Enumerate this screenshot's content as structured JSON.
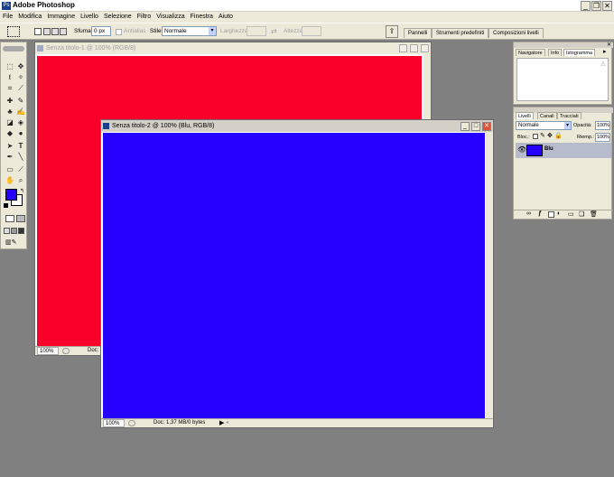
{
  "app": {
    "title": "Adobe Photoshop",
    "icon": "photoshop-icon"
  },
  "window_controls": [
    "_",
    "❐",
    "✕"
  ],
  "menu": [
    "File",
    "Modifica",
    "Immagine",
    "Livello",
    "Selezione",
    "Filtro",
    "Visualizza",
    "Finestra",
    "Aiuto"
  ],
  "options": {
    "sfuma_label": "Sfuma:",
    "sfuma_value": "0 px",
    "antialias_label": "Antialias",
    "stile_label": "Stile:",
    "stile_value": "Normale",
    "larghezza_label": "Larghezza:",
    "altezza_label": "Altezza:"
  },
  "palette_well_tabs": [
    "Pannelli",
    "Strumenti predefiniti",
    "Composizioni livelli"
  ],
  "doc1": {
    "title": "Senza titolo-1 @ 100% (RGB/8)",
    "zoom": "100%",
    "status": "Doc:",
    "color": "#f9002a"
  },
  "doc2": {
    "title": "Senza titolo-2 @ 100% (Blu, RGB/8)",
    "zoom": "100%",
    "status": "Doc: 1,37 MB/0 bytes",
    "color": "#2600ff"
  },
  "navigator": {
    "tabs": [
      "Navigatore",
      "Info",
      "Istogramma"
    ],
    "active": "Istogramma"
  },
  "layers": {
    "tabs": [
      "Livelli",
      "Canali",
      "Tracciati"
    ],
    "blend_mode": "Normale",
    "opacity_label": "Opacità:",
    "opacity_value": "100%",
    "lock_label": "Bloc.:",
    "fill_label": "Riemp.:",
    "fill_value": "100%",
    "layer_name": "Blu"
  },
  "colors": {
    "foreground": "#2500ff",
    "background": "#ffffff"
  }
}
